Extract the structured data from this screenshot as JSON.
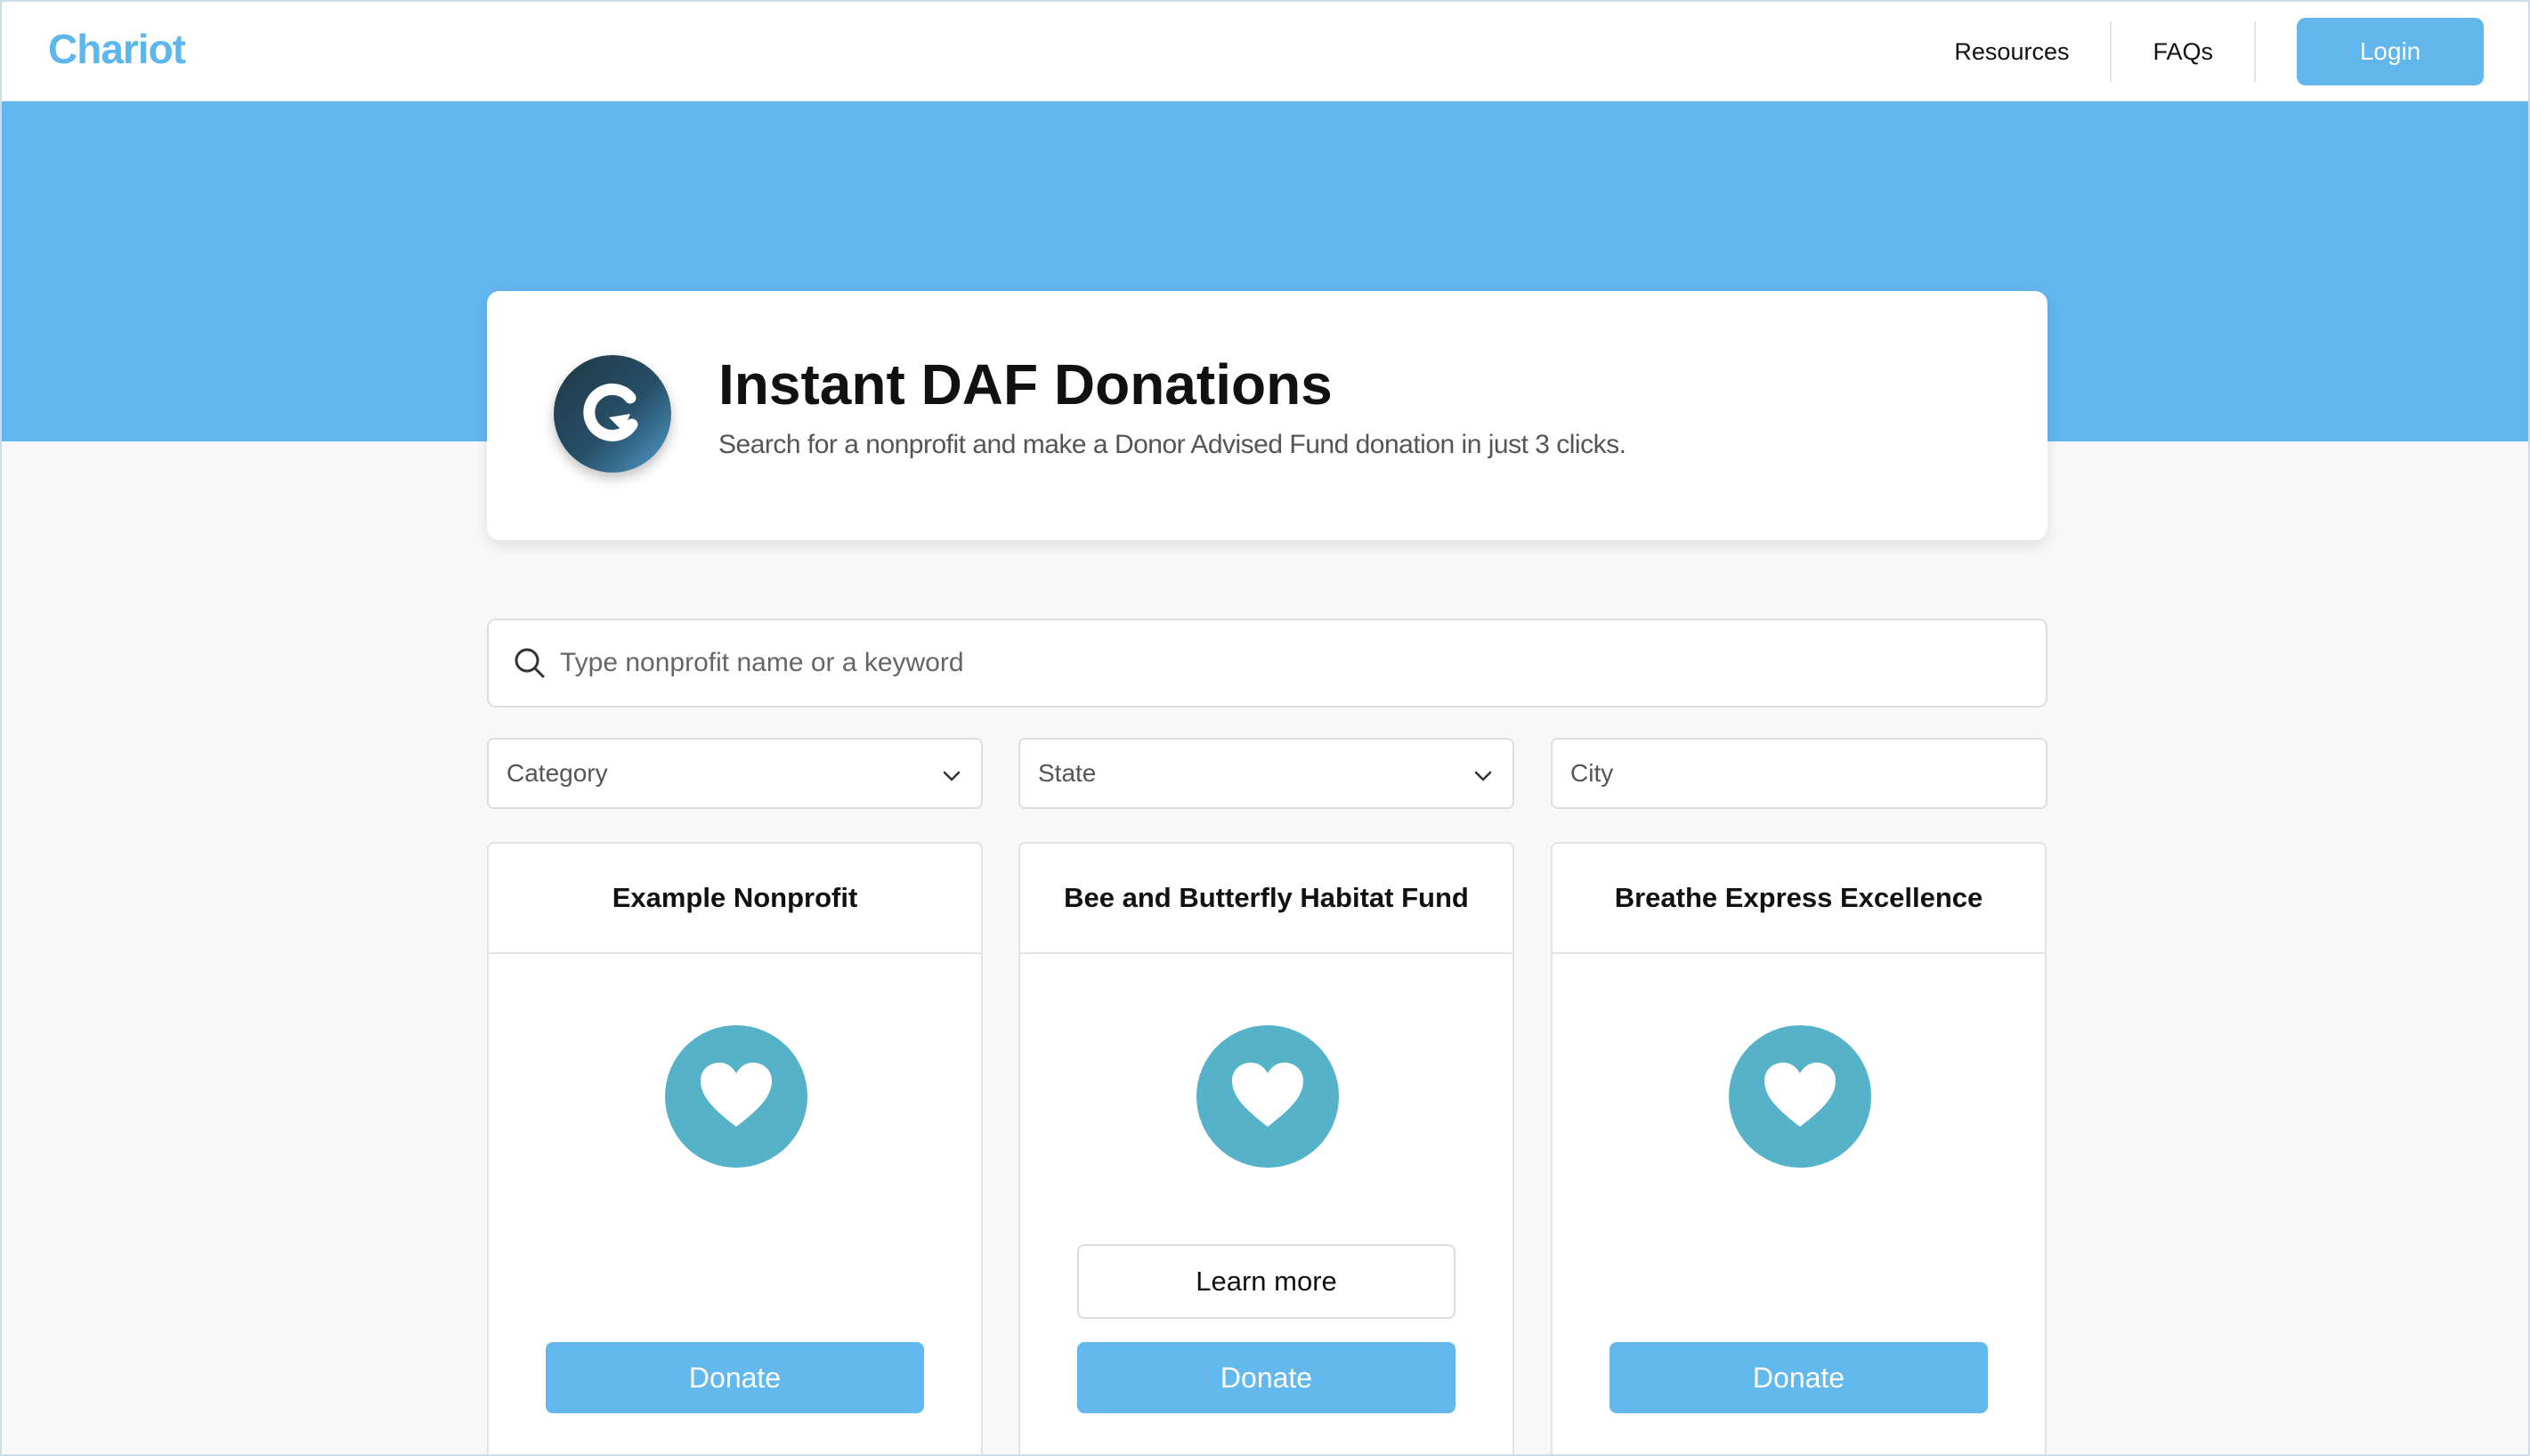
{
  "header": {
    "logo": "Chariot",
    "nav": [
      "Resources",
      "FAQs"
    ],
    "login_label": "Login"
  },
  "hero": {
    "title": "Instant DAF Donations",
    "subtitle": "Search for a nonprofit and make a Donor Advised Fund donation in just 3 clicks."
  },
  "search": {
    "placeholder": "Type nonprofit name or a keyword",
    "value": ""
  },
  "filters": {
    "category": "Category",
    "state": "State",
    "city": "City"
  },
  "cards": [
    {
      "name": "Example Nonprofit",
      "donate_label": "Donate"
    },
    {
      "name": "Bee and Butterfly Habitat Fund",
      "learn_label": "Learn more",
      "donate_label": "Donate"
    },
    {
      "name": "Breathe Express Excellence",
      "donate_label": "Donate"
    }
  ],
  "colors": {
    "accent": "#62b7ee",
    "heart_badge": "#55b2c8",
    "logo": "#5eb7ec"
  },
  "icons": [
    "search-icon",
    "chevron-down-icon",
    "heart-icon",
    "chariot-logo-icon"
  ]
}
